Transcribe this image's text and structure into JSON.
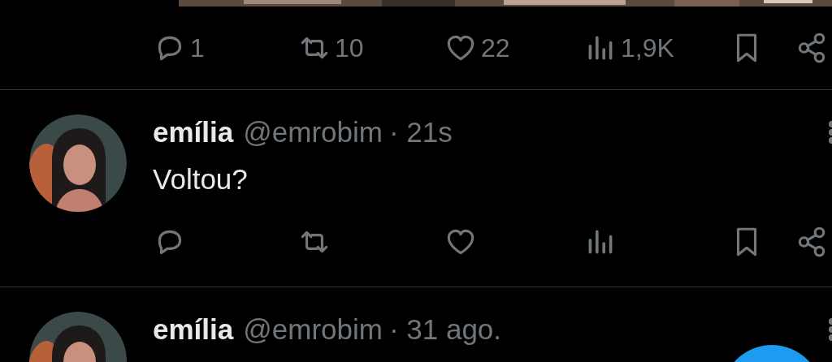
{
  "previous_post": {
    "actions": [
      {
        "kind": "reply",
        "count": "1"
      },
      {
        "kind": "repost",
        "count": "10"
      },
      {
        "kind": "like",
        "count": "22"
      },
      {
        "kind": "views",
        "count": "1,9K"
      },
      {
        "kind": "bookmark"
      },
      {
        "kind": "share"
      }
    ]
  },
  "posts": [
    {
      "name": "emília",
      "handle": "@emrobim",
      "time": "· 21s",
      "text": "Voltou?",
      "actions": [
        {
          "kind": "reply"
        },
        {
          "kind": "repost"
        },
        {
          "kind": "like"
        },
        {
          "kind": "views"
        },
        {
          "kind": "bookmark"
        },
        {
          "kind": "share"
        }
      ]
    },
    {
      "name": "emília",
      "handle": "@emrobim",
      "time": "· 31 ago."
    }
  ]
}
